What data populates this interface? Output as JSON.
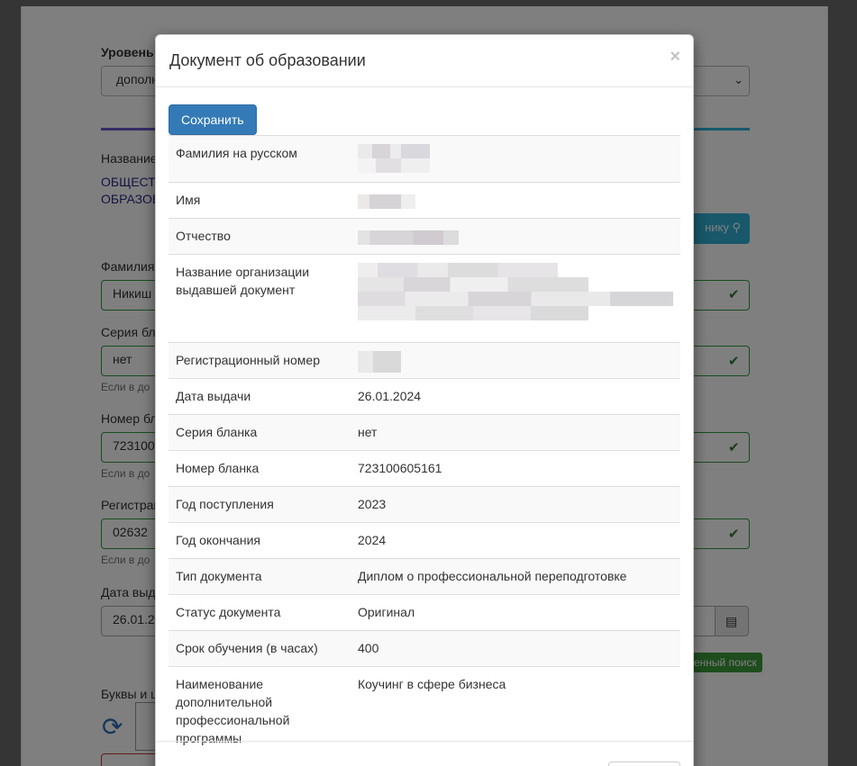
{
  "modal": {
    "title": "Документ об образовании",
    "close_symbol": "×",
    "save_label": "Сохранить",
    "rows": [
      {
        "label": "Фамилия на русском",
        "value": "",
        "redacted": true
      },
      {
        "label": "Имя",
        "value": "",
        "redacted": true
      },
      {
        "label": "Отчество",
        "value": "",
        "redacted": true
      },
      {
        "label": "Название организации выдавшей документ",
        "value": "",
        "redacted": true
      },
      {
        "label": "Регистрационный номер",
        "value": "",
        "redacted": true
      },
      {
        "label": "Дата выдачи",
        "value": "26.01.2024"
      },
      {
        "label": "Серия бланка",
        "value": "нет"
      },
      {
        "label": "Номер бланка",
        "value": "723100605161"
      },
      {
        "label": "Год поступления",
        "value": "2023"
      },
      {
        "label": "Год окончания",
        "value": "2024"
      },
      {
        "label": "Тип документа",
        "value": "Диплом о профессиональной переподготовке"
      },
      {
        "label": "Статус документа",
        "value": "Оригинал"
      },
      {
        "label": "Срок обучения (в часах)",
        "value": "400"
      },
      {
        "label": "Наименование дополнительной профессиональной программы",
        "value": "Коучинг в сфере бизнеса"
      }
    ]
  },
  "background": {
    "level_label": "Уровень",
    "level_select": "дополн",
    "name_label": "Название",
    "org_line1": "ОБЩЕСТ",
    "org_line2": "ОБРАЗОВ",
    "search_button": "нику",
    "surname_label": "Фамилия",
    "surname_value": "Никиш",
    "series_label": "Серия бл",
    "series_value": "нет",
    "series_help": "Если в до",
    "number_label": "Номер бл",
    "number_value": "723100",
    "number_help": "Если в до",
    "reg_label": "Регистрац",
    "reg_value": "02632",
    "reg_help": "Если в до",
    "date_label": "Дата выд",
    "date_value": "26.01.2",
    "ext_search_badge": "енный поиск",
    "captcha_label": "Буквы и ц",
    "accent_purple": "#6a5acd",
    "accent_teal": "#31b0d5"
  }
}
